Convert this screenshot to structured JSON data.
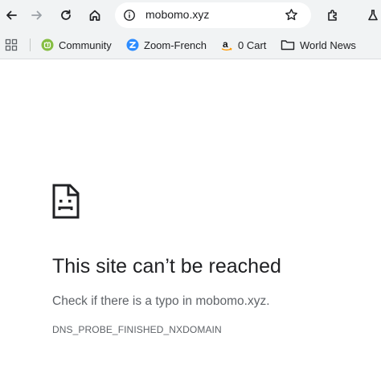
{
  "toolbar": {
    "url": "mobomo.xyz"
  },
  "bookmarks": [
    {
      "label": "Community",
      "icon": "linux-mint-icon"
    },
    {
      "label": "Zoom-French",
      "icon": "zoom-icon"
    },
    {
      "label": "0 Cart",
      "icon": "amazon-icon"
    },
    {
      "label": "World News",
      "icon": "folder-icon"
    }
  ],
  "error": {
    "title": "This site can’t be reached",
    "description": "Check if there is a typo in mobomo.xyz.",
    "code": "DNS_PROBE_FINISHED_NXDOMAIN"
  },
  "colors": {
    "toolbar_bg": "#f1f3f4",
    "mint_green": "#86be43",
    "zoom_blue": "#2d8cff",
    "amazon_orange": "#ff9900"
  }
}
